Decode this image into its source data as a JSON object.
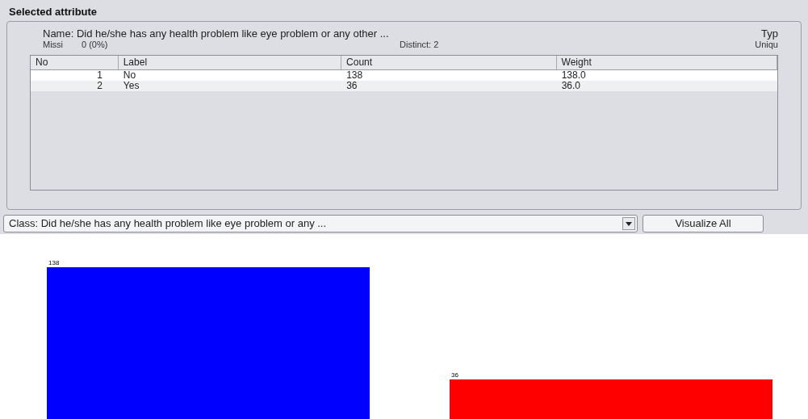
{
  "panel": {
    "title": "Selected attribute"
  },
  "attribute": {
    "name_label": "Name:",
    "name": "Did he/she has any health problem like eye problem or any other ...",
    "type_label": "Typ",
    "missing_label": "Missi",
    "missing": "0 (0%)",
    "distinct": "Distinct: 2",
    "unique_label": "Uniqu"
  },
  "table": {
    "columns": [
      "No",
      "Label",
      "Count",
      "Weight"
    ],
    "rows": [
      [
        "1",
        "No",
        "138",
        "138.0"
      ],
      [
        "2",
        "Yes",
        "36",
        "36.0"
      ]
    ]
  },
  "class_select": {
    "value": "Class: Did he/she has any health problem like eye problem or any ..."
  },
  "visualize_button": "Visualize All",
  "bar_chart": {
    "bars": [
      {
        "value_label": "138",
        "color": "#0000ff"
      },
      {
        "value_label": "36",
        "color": "#ff0000"
      }
    ]
  }
}
